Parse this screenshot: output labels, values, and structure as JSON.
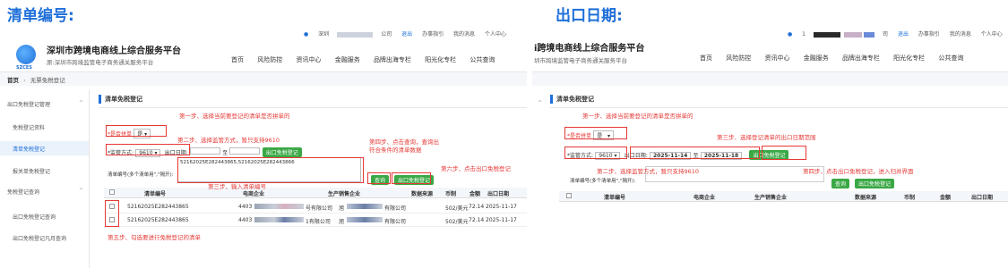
{
  "left": {
    "heading": "清单编号:",
    "topbar": [
      "深圳",
      "公司",
      "退出",
      "办事指引",
      "我的消息",
      "个人中心"
    ],
    "brand_title": "深圳市跨境电商线上综合服务平台",
    "brand_sub": "深圳市跨境监管电子商务通关服务平台",
    "brand_sub_prefix": "原:",
    "logo_text": "SZCES",
    "nav": [
      "首页",
      "风险防控",
      "资讯中心",
      "金融服务",
      "品牌出海专栏",
      "阳光化专栏",
      "公共查询"
    ],
    "breadcrumb_home": "首页",
    "breadcrumb_sep": "›",
    "breadcrumb_current": "无票免税登记",
    "sidebar": [
      "出口免税登记管理",
      "免税登记资料",
      "清单免税登记",
      "报关单免税登记",
      "免税登记查询",
      "出口免税登记查询",
      "出口免税登记凡月查询"
    ],
    "panel_title": "清单免税登记",
    "form": {
      "merge_label": "*是否拼单",
      "merge_value": "是",
      "mode_label": "*监管方式:",
      "mode_value": "9610",
      "export_date_label": "出口日期:",
      "date_sep": "至",
      "register_btn": "出口免税登记",
      "list_label": "清单编号(多个清单用\",\"隔开):",
      "list_value": "52162025E282443865,52162025E282443866",
      "query_btn": "查询",
      "register_btn2": "出口免税登记"
    },
    "table_headers": [
      "清单编号",
      "电商企业",
      "生产销售企业",
      "数据来源",
      "币制",
      "金额",
      "出口日期"
    ],
    "rows": [
      {
        "id": "52162025E282443865",
        "ecom_prefix": "4403",
        "ecom_suffix": "号有限公司",
        "prod_prefix": "旭",
        "prod_suffix": "有限公司",
        "source": "",
        "currency": "502/美元",
        "amount": "72.14",
        "date": "2025-11-17"
      },
      {
        "id": "52162025E282443865",
        "ecom_prefix": "4403",
        "ecom_suffix": "1有限公司",
        "prod_prefix": "旭",
        "prod_suffix": "有限公司",
        "source": "",
        "currency": "502/美元",
        "amount": "72.14",
        "date": "2025-11-17"
      }
    ],
    "annotations": {
      "step1": "第一步、选择当前要登记的清单是否拼单的",
      "step2": "第二步、选择监管方式，暂只支持9610",
      "step3": "第三步、输入清单编号",
      "step4": "第四步、点击查询，查询出符合条件的清单数据",
      "step5": "第五步、勾选要进行免税登记的清单",
      "step6": "第六步、点击出口免税登记"
    }
  },
  "right": {
    "heading": "出口日期:",
    "topbar": [
      "1",
      "司",
      "退出",
      "办事指引",
      "我的消息",
      "个人中心"
    ],
    "brand_title": "i跨境电商线上综合服务平台",
    "brand_sub": "圳市跨境监管电子商务通关服务平台",
    "nav": [
      "首页",
      "风险防控",
      "资讯中心",
      "金融服务",
      "品牌出海专栏",
      "阳光化专栏",
      "公共查询"
    ],
    "panel_title": "清单免税登记",
    "form": {
      "merge_label": "*是否拼单",
      "merge_value": "是",
      "mode_label": "*监管方式:",
      "mode_value": "9610",
      "export_date_label": "出口日期:",
      "date_from": "2025-11-14",
      "date_sep": "至",
      "date_to": "2025-11-18",
      "register_btn": "出口免税登记",
      "list_label": "清单编号(多个清单用\",\"隔开):",
      "query_btn": "查询",
      "register_btn2": "出口免税登记"
    },
    "table_headers": [
      "清单编号",
      "电商企业",
      "生产销售企业",
      "数据来源",
      "币制",
      "金额",
      "出口日期"
    ],
    "annotations": {
      "step1": "第一步、选择当前要登记的清单是否拼单的",
      "step3": "第三步、选择登记清单的出口日期范围",
      "step2": "第二步、选择监管方式，暂只支持9610",
      "step4": "第四步、点击出口免税登记，进入归并界面"
    }
  },
  "colors": {
    "accent": "#1e6fd9",
    "annotation": "#e53935",
    "button": "#3aa845"
  }
}
